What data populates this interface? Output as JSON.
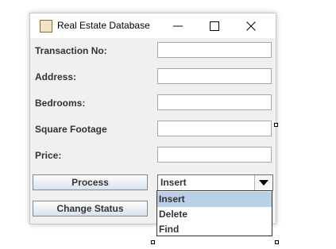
{
  "window": {
    "title": "Real Estate Database"
  },
  "fields": [
    {
      "label": "Transaction No:",
      "value": ""
    },
    {
      "label": "Address:",
      "value": ""
    },
    {
      "label": "Bedrooms:",
      "value": ""
    },
    {
      "label": "Square Footage",
      "value": ""
    },
    {
      "label": "Price:",
      "value": ""
    }
  ],
  "buttons": {
    "process": "Process",
    "change_status": "Change Status"
  },
  "combo": {
    "selected": "Insert",
    "options": [
      "Insert",
      "Delete",
      "Find"
    ],
    "highlighted": "Insert"
  }
}
